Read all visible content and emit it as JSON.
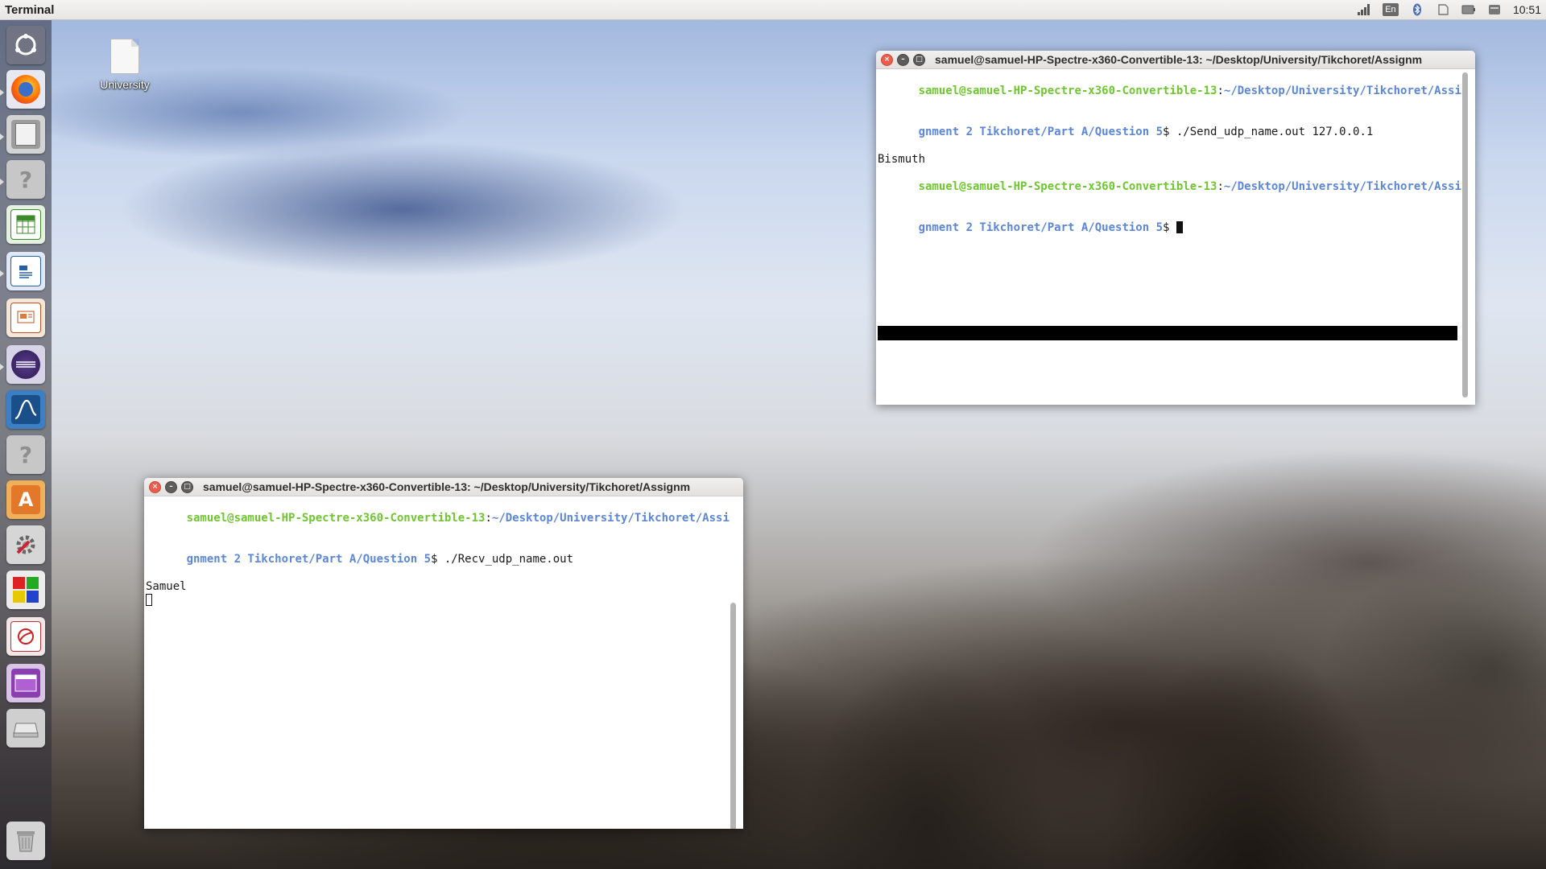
{
  "top_panel": {
    "app_title": "Terminal",
    "keyboard_layout": "En",
    "clock": "10:51",
    "indicator_icons": [
      "network-signal-icon",
      "keyboard-layout-indicator",
      "bluetooth-icon",
      "session-icon",
      "battery-icon",
      "messaging-icon"
    ]
  },
  "launcher": {
    "items": [
      "ubuntu-dash-icon",
      "firefox-icon",
      "files-icon",
      "unknown-app-icon",
      "libreoffice-calc-icon",
      "libreoffice-writer-icon",
      "libreoffice-impress-icon",
      "eclipse-icon",
      "oscilloscope-app-icon",
      "unknown-app-icon",
      "software-center-icon",
      "system-settings-icon",
      "colorful-app-icon",
      "evince-icon",
      "workspace-switcher-icon",
      "drive-icon",
      "trash-icon"
    ]
  },
  "desktop": {
    "icon_label": "University"
  },
  "terminal_top": {
    "title": "samuel@samuel-HP-Spectre-x360-Convertible-13: ~/Desktop/University/Tikchoret/Assignm",
    "lines": [
      {
        "user": "samuel@samuel-HP-Spectre-x360-Convertible-13",
        "sep": ":",
        "path": "~/Desktop/University/Tikchoret/Assi"
      },
      {
        "path": "gnment 2 Tikchoret/Part A/Question 5",
        "prompt": "$ ./Send_udp_name.out 127.0.0.1"
      },
      {
        "text": "Bismuth"
      },
      {
        "user": "samuel@samuel-HP-Spectre-x360-Convertible-13",
        "sep": ":",
        "path": "~/Desktop/University/Tikchoret/Assi"
      },
      {
        "path": "gnment 2 Tikchoret/Part A/Question 5",
        "prompt": "$ "
      }
    ]
  },
  "terminal_bottom": {
    "title": "samuel@samuel-HP-Spectre-x360-Convertible-13: ~/Desktop/University/Tikchoret/Assignm",
    "lines": [
      {
        "user": "samuel@samuel-HP-Spectre-x360-Convertible-13",
        "sep": ":",
        "path": "~/Desktop/University/Tikchoret/Assi"
      },
      {
        "path": "gnment 2 Tikchoret/Part A/Question 5",
        "prompt": "$ ./Recv_udp_name.out"
      },
      {
        "text": "Samuel"
      }
    ]
  },
  "colors": {
    "prompt_user": "#6fc630",
    "prompt_path": "#5c86d6",
    "close_button": "#ee5c4c"
  }
}
